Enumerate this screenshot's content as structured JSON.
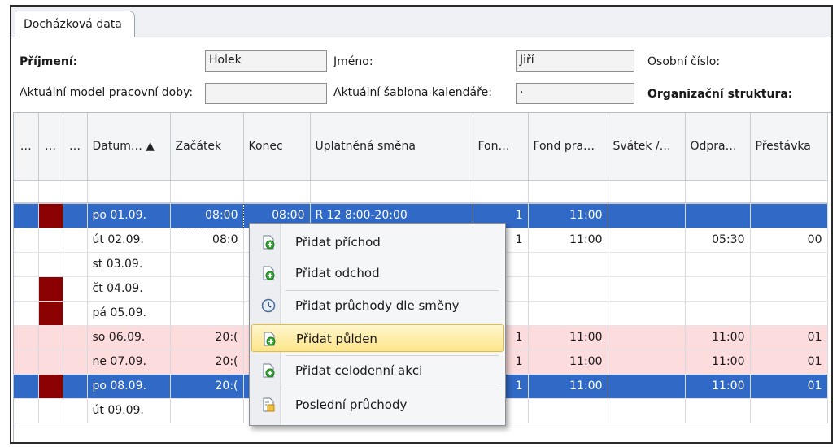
{
  "tab": {
    "label": "Docházková data"
  },
  "form": {
    "surname_label": "Příjmení:",
    "surname_value": "Holek",
    "firstname_label": "Jméno:",
    "firstname_value": "Jiří",
    "personal_number_label": "Osobní číslo:",
    "work_model_label": "Aktuální model pracovní doby:",
    "work_model_value": "",
    "calendar_template_label": "Aktuální šablona kalendáře:",
    "calendar_template_value": "·",
    "org_structure_label": "Organizační struktura:"
  },
  "grid": {
    "columns": [
      "…",
      "…",
      "…",
      "Datum… ▲",
      "Začátek",
      "Konec",
      "Uplatněná směna",
      "Fon…",
      "Fond pra…",
      "Svátek /…",
      "Odpra…",
      "Přestávka"
    ],
    "rows": [
      {
        "date": "po 01.09.",
        "start": "08:00",
        "end": "08:00",
        "shift": "R 12 8:00-20:00",
        "fon": "1",
        "fond": "11:00",
        "worked": "",
        "pause": "",
        "style": "sel",
        "marker": true
      },
      {
        "date": "út 02.09.",
        "start": "08:0",
        "end": "",
        "shift": "",
        "fon": "1",
        "fond": "11:00",
        "worked": "05:30",
        "pause": "00",
        "style": "",
        "marker": false
      },
      {
        "date": "st 03.09.",
        "start": "",
        "end": "",
        "shift": "",
        "fon": "",
        "fond": "",
        "worked": "",
        "pause": "",
        "style": "",
        "marker": false
      },
      {
        "date": "čt 04.09.",
        "start": "",
        "end": "",
        "shift": "",
        "fon": "",
        "fond": "",
        "worked": "",
        "pause": "",
        "style": "",
        "marker": true
      },
      {
        "date": "pá 05.09.",
        "start": "",
        "end": "",
        "shift": "",
        "fon": "",
        "fond": "",
        "worked": "",
        "pause": "",
        "style": "",
        "marker": true
      },
      {
        "date": "so 06.09.",
        "start": "20:(",
        "end": "",
        "shift": "",
        "fon": "1",
        "fond": "11:00",
        "worked": "11:00",
        "pause": "01",
        "style": "pink",
        "marker": false
      },
      {
        "date": "ne 07.09.",
        "start": "20:(",
        "end": "",
        "shift": "",
        "fon": "1",
        "fond": "11:00",
        "worked": "11:00",
        "pause": "01",
        "style": "pink",
        "marker": false
      },
      {
        "date": "po 08.09.",
        "start": "20:(",
        "end": "",
        "shift": "",
        "fon": "1",
        "fond": "11:00",
        "worked": "11:00",
        "pause": "01",
        "style": "sel",
        "marker": true
      },
      {
        "date": "út 09.09.",
        "start": "",
        "end": "",
        "shift": "",
        "fon": "",
        "fond": "",
        "worked": "",
        "pause": "",
        "style": "",
        "marker": false
      }
    ]
  },
  "context_menu": {
    "items": [
      {
        "label": "Přidat příchod",
        "icon": "doc-plus-icon"
      },
      {
        "label": "Přidat odchod",
        "icon": "doc-plus-icon"
      },
      {
        "label": "Přidat průchody dle směny",
        "icon": "clock-icon"
      },
      {
        "label": "Přidat půlden",
        "icon": "doc-plus-icon",
        "highlighted": true
      },
      {
        "label": "Přidat celodenní akci",
        "icon": "doc-plus-icon"
      },
      {
        "label": "Poslední průchody",
        "icon": "doc-list-icon"
      }
    ]
  },
  "colors": {
    "selection": "#3169c6",
    "marker": "#8b0000",
    "weekend": "#fcdcdc",
    "menu_highlight": "#fde58a"
  }
}
